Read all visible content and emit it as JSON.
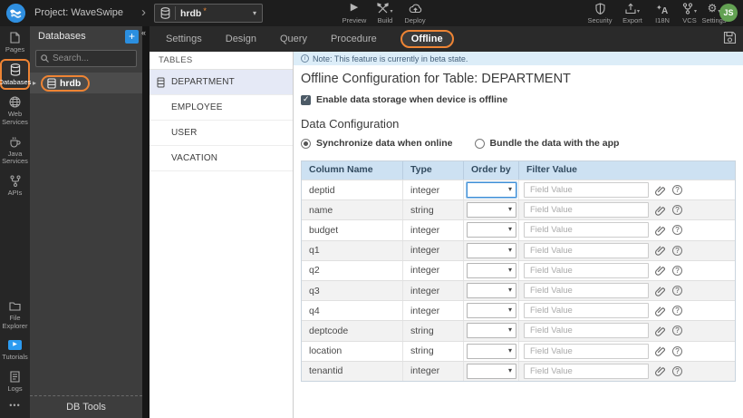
{
  "topbar": {
    "project_label": "Project: WaveSwipe",
    "db_selector": {
      "value": "hrdb",
      "modified_marker": "*"
    },
    "actions": {
      "preview": "Preview",
      "build": "Build",
      "deploy": "Deploy"
    },
    "tools": {
      "security": "Security",
      "export": "Export",
      "i18n": "I18N",
      "vcs": "VCS",
      "settings": "Settings"
    },
    "avatar_initials": "JS"
  },
  "sidebar": {
    "items": [
      {
        "label": "Pages",
        "active": false
      },
      {
        "label": "Databases",
        "active": true
      },
      {
        "label": "Web Services",
        "active": false
      },
      {
        "label": "Java Services",
        "active": false
      },
      {
        "label": "APIs",
        "active": false
      }
    ],
    "bottom_items": [
      {
        "label": "File Explorer"
      },
      {
        "label": "Tutorials"
      },
      {
        "label": "Logs"
      }
    ]
  },
  "db_panel": {
    "title": "Databases",
    "search_placeholder": "Search...",
    "db_name": "hrdb",
    "footer": "DB Tools"
  },
  "tabs": {
    "items": [
      {
        "label": "Settings",
        "active": false
      },
      {
        "label": "Design",
        "active": false
      },
      {
        "label": "Query",
        "active": false
      },
      {
        "label": "Procedure",
        "active": false
      },
      {
        "label": "Offline",
        "active": true
      }
    ]
  },
  "tables_panel": {
    "title": "TABLES",
    "items": [
      {
        "label": "DEPARTMENT",
        "selected": true
      },
      {
        "label": "EMPLOYEE",
        "selected": false
      },
      {
        "label": "USER",
        "selected": false
      },
      {
        "label": "VACATION",
        "selected": false
      }
    ]
  },
  "content": {
    "note": "Note: This feature is currently in beta state.",
    "title": "Offline Configuration for Table: DEPARTMENT",
    "enable_label": "Enable data storage when device is offline",
    "enable_checked": true,
    "section_title": "Data Configuration",
    "radios": [
      {
        "label": "Synchronize data when online",
        "selected": true
      },
      {
        "label": "Bundle the data with the app",
        "selected": false
      }
    ],
    "table": {
      "headers": [
        "Column Name",
        "Type",
        "Order by",
        "Filter Value"
      ],
      "filter_placeholder": "Field Value",
      "rows": [
        {
          "column": "deptid",
          "type": "integer"
        },
        {
          "column": "name",
          "type": "string"
        },
        {
          "column": "budget",
          "type": "integer"
        },
        {
          "column": "q1",
          "type": "integer"
        },
        {
          "column": "q2",
          "type": "integer"
        },
        {
          "column": "q3",
          "type": "integer"
        },
        {
          "column": "q4",
          "type": "integer"
        },
        {
          "column": "deptcode",
          "type": "string"
        },
        {
          "column": "location",
          "type": "string"
        },
        {
          "column": "tenantid",
          "type": "integer"
        }
      ]
    }
  },
  "colors": {
    "accent_orange": "#ee8434",
    "accent_blue": "#2b8fe0",
    "note_bg": "#dcedf8",
    "table_header_bg": "#cde1f2",
    "avatar_green": "#63a153",
    "selected_row_bg": "#e5e9f6"
  }
}
